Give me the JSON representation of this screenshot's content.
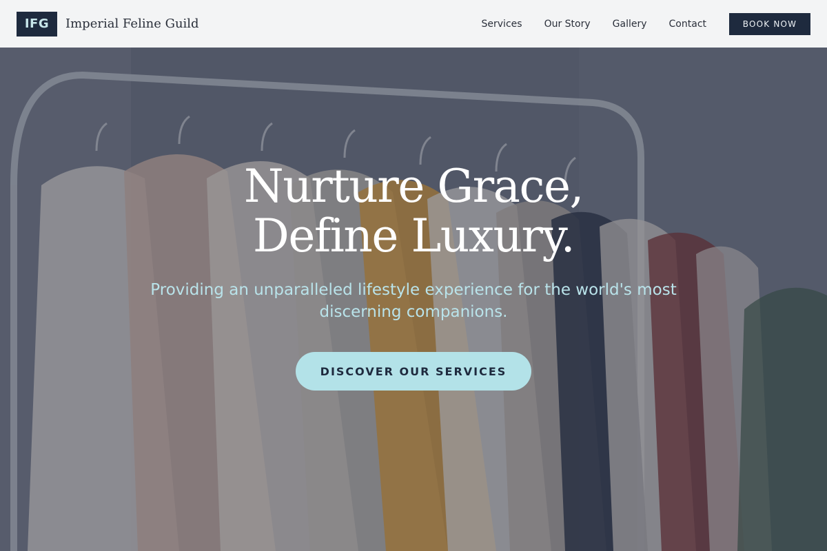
{
  "brand": {
    "logo_text": "IFG",
    "name": "Imperial Feline Guild"
  },
  "nav": {
    "items": [
      {
        "label": "Services"
      },
      {
        "label": "Our Story"
      },
      {
        "label": "Gallery"
      },
      {
        "label": "Contact"
      }
    ],
    "cta_label": "BOOK NOW"
  },
  "hero": {
    "title": "Nurture Grace, Define Luxury.",
    "subtitle": "Providing an unparalleled lifestyle experience for the world's most discerning companions.",
    "cta_label": "DISCOVER OUR SERVICES",
    "background_image": "clothing-rack-photo"
  },
  "colors": {
    "navy": "#1e2a3e",
    "accent_cyan": "#b3e2e8",
    "header_bg": "#f3f4f5"
  }
}
